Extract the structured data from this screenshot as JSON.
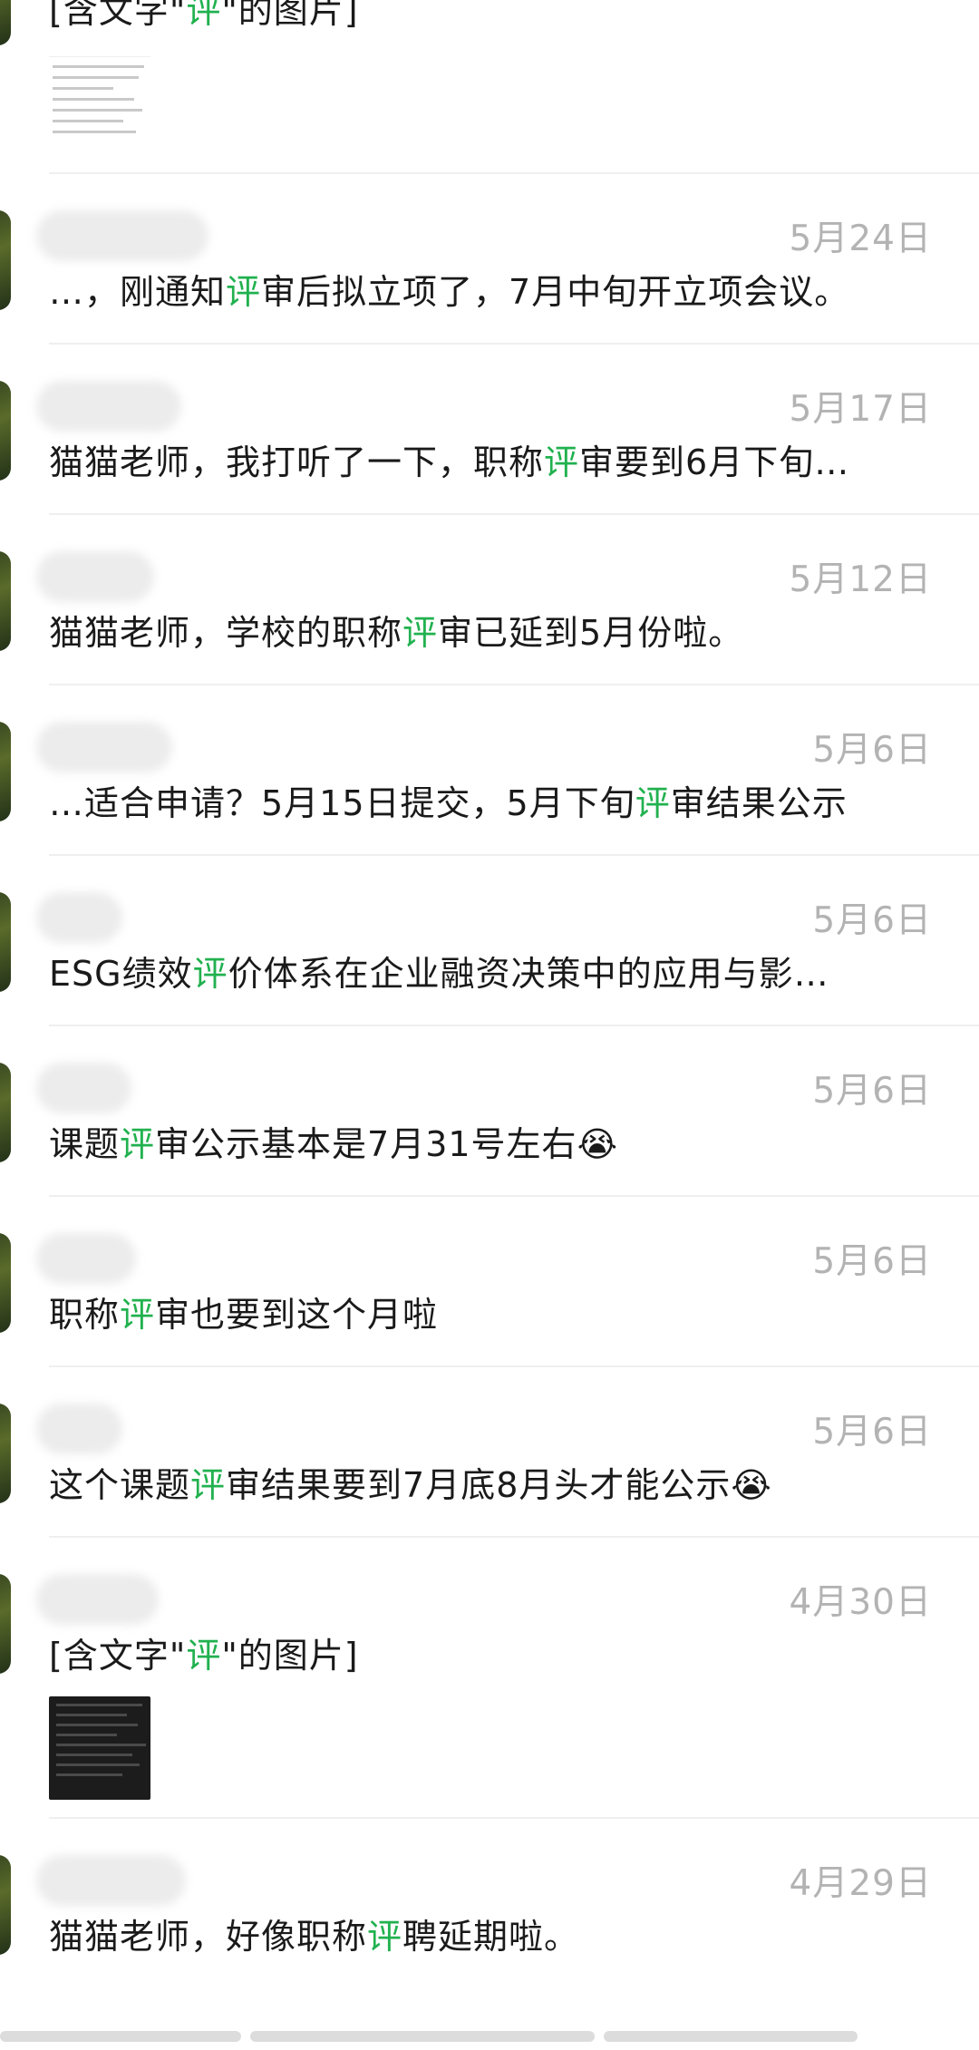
{
  "search": {
    "keyword": "评"
  },
  "colors": {
    "highlight": "#21b14f",
    "date": "#b3b3b3",
    "text": "#1a1a1a"
  },
  "results": [
    {
      "type": "image",
      "date": "",
      "pre": "[含文字\"",
      "hl": "评",
      "post": "\"的图片]",
      "thumbnail": "document-screenshot"
    },
    {
      "type": "text",
      "date": "5月24日",
      "pre": "…，刚通知",
      "hl": "评",
      "post": "审后拟立项了，7月中旬开立项会议。"
    },
    {
      "type": "text",
      "date": "5月17日",
      "pre": "猫猫老师，我打听了一下，职称",
      "hl": "评",
      "post": "审要到6月下旬…"
    },
    {
      "type": "text",
      "date": "5月12日",
      "pre": "猫猫老师，学校的职称",
      "hl": "评",
      "post": "审已延到5月份啦。"
    },
    {
      "type": "text",
      "date": "5月6日",
      "pre": "…适合申请？5月15日提交，5月下旬",
      "hl": "评",
      "post": "审结果公示"
    },
    {
      "type": "text",
      "date": "5月6日",
      "pre": "ESG绩效",
      "hl": "评",
      "post": "价体系在企业融资决策中的应用与影…"
    },
    {
      "type": "text",
      "date": "5月6日",
      "pre": "课题",
      "hl": "评",
      "post": "审公示基本是7月31号左右😭"
    },
    {
      "type": "text",
      "date": "5月6日",
      "pre": "职称",
      "hl": "评",
      "post": "审也要到这个月啦"
    },
    {
      "type": "text",
      "date": "5月6日",
      "pre": "这个课题",
      "hl": "评",
      "post": "审结果要到7月底8月头才能公示😭"
    },
    {
      "type": "image",
      "date": "4月30日",
      "pre": "[含文字\"",
      "hl": "评",
      "post": "\"的图片]",
      "thumbnail": "chat-screenshot"
    },
    {
      "type": "text",
      "date": "4月29日",
      "pre": "猫猫老师，好像职称",
      "hl": "评",
      "post": "聘延期啦。"
    }
  ]
}
